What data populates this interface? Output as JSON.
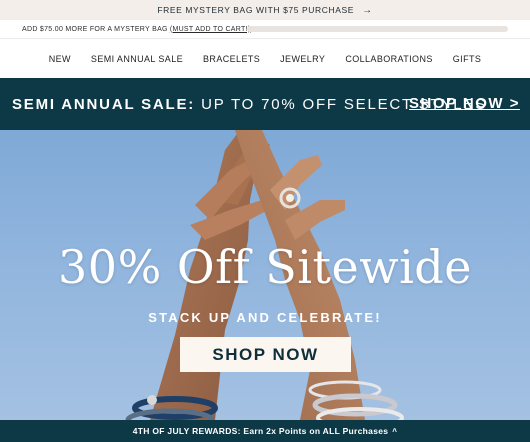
{
  "promo_bar": {
    "text": "FREE MYSTERY BAG WITH $75 PURCHASE",
    "arrow_icon": "arrow-right-icon"
  },
  "progress": {
    "message": "ADD $75.00 MORE FOR A MYSTERY BAG",
    "link_label": "(MUST ADD TO CART!)",
    "fill": 0
  },
  "nav": {
    "items": [
      "NEW",
      "SEMI ANNUAL SALE",
      "BRACELETS",
      "JEWELRY",
      "COLLABORATIONS",
      "GIFTS"
    ]
  },
  "sale_banner": {
    "label": "SEMI ANNUAL SALE:",
    "text": "UP TO 70% OFF SELECT STYLES",
    "cta": "SHOP NOW >",
    "background": "#0d3947"
  },
  "hero": {
    "title": "30% Off Sitewide",
    "subtitle": "STACK UP AND CELEBRATE!",
    "cta": "SHOP NOW"
  },
  "rewards_bar": {
    "text": "4TH OF JULY REWARDS: Earn 2x Points on ALL Purchases",
    "chevron_icon": "chevron-up-icon"
  }
}
